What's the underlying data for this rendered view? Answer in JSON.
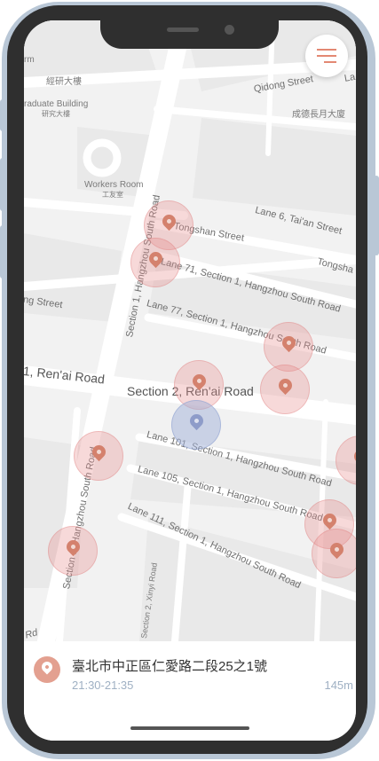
{
  "map": {
    "labels": {
      "rm": "rm",
      "jingyan_building": "經研大樓",
      "graduate_building": "raduate Building",
      "graduate_building_zh": "研究大樓",
      "qidong_street": "Qidong Street",
      "la": "La",
      "chengde_building": "成德長月大廈",
      "workers_room": "Workers Room",
      "workers_room_zh": "工友室",
      "section1_hangzhou_north": "Section 1, Hangzhou South Road",
      "lane6_taian": "Lane 6, Tai'an Street",
      "tongshan_street": "Tongshan Street",
      "tongsha": "Tongsha",
      "lane71": "Lane 71, Section 1, Hangzhou South Road",
      "ng_street": "ng Street",
      "lane77": "Lane 77, Section 1, Hangzhou South Road",
      "renai_road_left": "1, Ren'ai Road",
      "section2_renai": "Section 2, Ren'ai Road",
      "lane101": "Lane 101, Section 1, Hangzhou South Road",
      "lane105": "Lane 105, Section 1, Hangzhou South Road",
      "section1_hangzhou_south": "Section 1, Hangzhou South Road",
      "lane111": "Lane 111, Section 1, Hangzhou South Road",
      "section2_xinyi": "Section 2, Xinyi Road",
      "rd": "Rd"
    }
  },
  "menu": {
    "icon": "hamburger-menu-icon"
  },
  "selected_location": {
    "address": "臺北市中正區仁愛路二段25之1號",
    "time_range": "21:30-21:35",
    "distance": "145m"
  },
  "colors": {
    "accent": "#e38873",
    "pin": "#d4816d",
    "selected_pin": "#8e9cc9",
    "secondary_text": "#9fb0c3",
    "frame": "#b9c7d6"
  }
}
